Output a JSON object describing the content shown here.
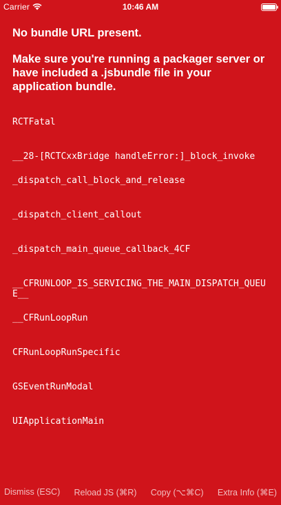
{
  "status_bar": {
    "carrier": "Carrier",
    "time": "10:46 AM"
  },
  "error": {
    "title": "No bundle URL present.",
    "message": "Make sure you're running a packager server or have included a .jsbundle file in your application bundle."
  },
  "stack_trace": [
    "RCTFatal",
    "__28-[RCTCxxBridge handleError:]_block_invoke",
    "_dispatch_call_block_and_release",
    "_dispatch_client_callout",
    "_dispatch_main_queue_callback_4CF",
    "__CFRUNLOOP_IS_SERVICING_THE_MAIN_DISPATCH_QUEUE__",
    "__CFRunLoopRun",
    "CFRunLoopRunSpecific",
    "GSEventRunModal",
    "UIApplicationMain"
  ],
  "toolbar": {
    "dismiss_label": "Dismiss (ESC)",
    "reload_label": "Reload JS (⌘R)",
    "copy_label": "Copy (⌥⌘C)",
    "extra_info_label": "Extra Info (⌘E)"
  },
  "colors": {
    "background": "#D0141B",
    "text": "#FFFFFF"
  },
  "icons": {
    "wifi": "wifi-icon",
    "battery": "battery-icon"
  }
}
